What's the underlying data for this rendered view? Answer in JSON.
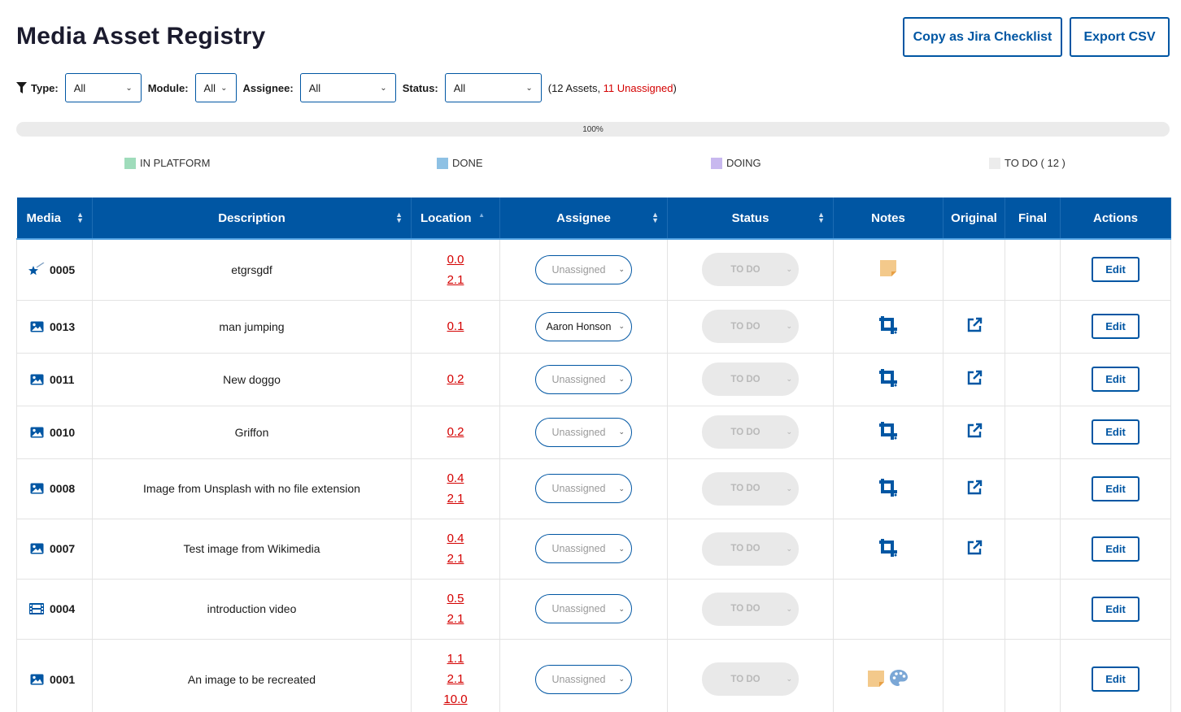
{
  "page": {
    "title": "Media Asset Registry",
    "copy_jira_label": "Copy as Jira Checklist",
    "export_csv_label": "Export CSV"
  },
  "filters": {
    "type_label": "Type:",
    "type_value": "All",
    "module_label": "Module:",
    "module_value": "All",
    "assignee_label": "Assignee:",
    "assignee_value": "All",
    "status_label": "Status:",
    "status_value": "All",
    "summary_prefix": "(12 Assets, ",
    "summary_unassigned": "11 Unassigned",
    "summary_suffix": ")"
  },
  "progress": {
    "label": "100%",
    "value": 100
  },
  "legend": {
    "in_platform": "IN PLATFORM",
    "done": "DONE",
    "doing": "DOING",
    "todo": "TO DO ( 12 )"
  },
  "colors": {
    "accent": "#0056a3",
    "in_platform": "#9fdcbb",
    "done": "#8ec1e4",
    "doing": "#c8b8ef",
    "todo": "#ececec",
    "link_red": "#d40000"
  },
  "table": {
    "headers": {
      "media": "Media",
      "description": "Description",
      "location": "Location",
      "assignee": "Assignee",
      "status": "Status",
      "notes": "Notes",
      "original": "Original",
      "final": "Final",
      "actions": "Actions"
    },
    "rows": [
      {
        "type_icon": "magic-wand-icon",
        "id": "0005",
        "description": "etgrsgdf",
        "locations": [
          "0.0",
          "2.1"
        ],
        "assignee": "Unassigned",
        "status": "TO DO",
        "notes": [
          "sticky-note-icon"
        ],
        "original": false,
        "edit": "Edit"
      },
      {
        "type_icon": "image-icon",
        "id": "0013",
        "description": "man jumping",
        "locations": [
          "0.1"
        ],
        "assignee": "Aaron Honson",
        "status": "TO DO",
        "notes": [
          "crop-icon"
        ],
        "original": true,
        "edit": "Edit"
      },
      {
        "type_icon": "image-icon",
        "id": "0011",
        "description": "New doggo",
        "locations": [
          "0.2"
        ],
        "assignee": "Unassigned",
        "status": "TO DO",
        "notes": [
          "crop-icon"
        ],
        "original": true,
        "edit": "Edit"
      },
      {
        "type_icon": "image-icon",
        "id": "0010",
        "description": "Griffon",
        "locations": [
          "0.2"
        ],
        "assignee": "Unassigned",
        "status": "TO DO",
        "notes": [
          "crop-icon"
        ],
        "original": true,
        "edit": "Edit"
      },
      {
        "type_icon": "image-icon",
        "id": "0008",
        "description": "Image from Unsplash with no file extension",
        "locations": [
          "0.4",
          "2.1"
        ],
        "assignee": "Unassigned",
        "status": "TO DO",
        "notes": [
          "crop-icon"
        ],
        "original": true,
        "edit": "Edit"
      },
      {
        "type_icon": "image-icon",
        "id": "0007",
        "description": "Test image from Wikimedia",
        "locations": [
          "0.4",
          "2.1"
        ],
        "assignee": "Unassigned",
        "status": "TO DO",
        "notes": [
          "crop-icon"
        ],
        "original": true,
        "edit": "Edit"
      },
      {
        "type_icon": "film-icon",
        "id": "0004",
        "description": "introduction video",
        "locations": [
          "0.5",
          "2.1"
        ],
        "assignee": "Unassigned",
        "status": "TO DO",
        "notes": [],
        "original": false,
        "edit": "Edit"
      },
      {
        "type_icon": "image-icon",
        "id": "0001",
        "description": "An image to be recreated",
        "locations": [
          "1.1",
          "2.1",
          "10.0"
        ],
        "assignee": "Unassigned",
        "status": "TO DO",
        "notes": [
          "sticky-note-icon",
          "palette-icon"
        ],
        "original": false,
        "edit": "Edit"
      }
    ]
  }
}
